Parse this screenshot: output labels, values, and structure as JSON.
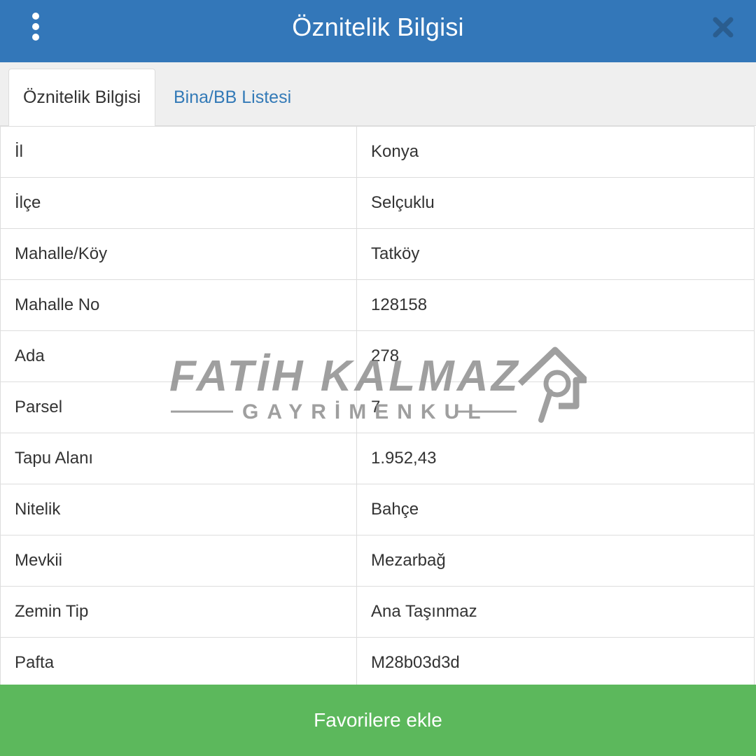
{
  "header": {
    "title": "Öznitelik Bilgisi",
    "menu_icon": "vertical-dots-icon",
    "close_icon": "close-icon",
    "color": "#3377b9"
  },
  "tabs": [
    {
      "label": "Öznitelik Bilgisi",
      "active": true
    },
    {
      "label": "Bina/BB Listesi",
      "active": false
    }
  ],
  "attributes": [
    {
      "key": "İl",
      "value": "Konya"
    },
    {
      "key": "İlçe",
      "value": "Selçuklu"
    },
    {
      "key": "Mahalle/Köy",
      "value": "Tatköy"
    },
    {
      "key": "Mahalle No",
      "value": "128158"
    },
    {
      "key": "Ada",
      "value": "278"
    },
    {
      "key": "Parsel",
      "value": "7"
    },
    {
      "key": "Tapu Alanı",
      "value": "1.952,43"
    },
    {
      "key": "Nitelik",
      "value": "Bahçe"
    },
    {
      "key": "Mevkii",
      "value": "Mezarbağ"
    },
    {
      "key": "Zemin Tip",
      "value": "Ana Taşınmaz"
    },
    {
      "key": "Pafta",
      "value": "M28b03d3d"
    }
  ],
  "footer": {
    "button_label": "Favorilere ekle",
    "color": "#5cb85c"
  },
  "watermark": {
    "name": "FATİH KALMAZ",
    "tagline": "GAYRİMENKUL"
  }
}
